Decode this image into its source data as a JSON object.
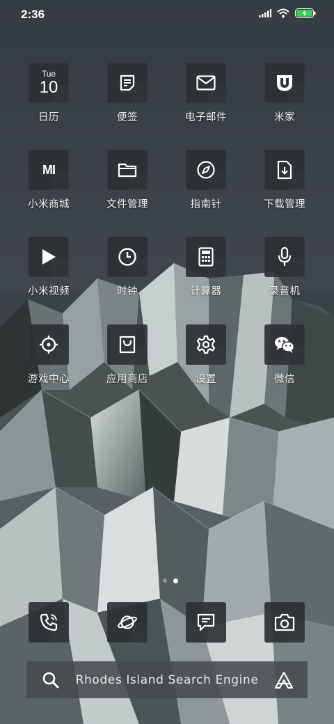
{
  "status": {
    "time": "2:36"
  },
  "calendar": {
    "dow": "Tue",
    "day": "10"
  },
  "apps": [
    {
      "label": "日历",
      "icon": "calendar-icon"
    },
    {
      "label": "便签",
      "icon": "notes-icon"
    },
    {
      "label": "电子邮件",
      "icon": "mail-icon"
    },
    {
      "label": "米家",
      "icon": "mijia-icon"
    },
    {
      "label": "小米商城",
      "icon": "mi-logo-icon",
      "logo": "MI"
    },
    {
      "label": "文件管理",
      "icon": "folder-icon"
    },
    {
      "label": "指南针",
      "icon": "compass-icon"
    },
    {
      "label": "下载管理",
      "icon": "download-icon"
    },
    {
      "label": "小米视频",
      "icon": "play-icon"
    },
    {
      "label": "时钟",
      "icon": "clock-icon"
    },
    {
      "label": "计算器",
      "icon": "calculator-icon"
    },
    {
      "label": "录音机",
      "icon": "microphone-icon"
    },
    {
      "label": "游戏中心",
      "icon": "crosshair-icon"
    },
    {
      "label": "应用商店",
      "icon": "shopping-bag-icon"
    },
    {
      "label": "设置",
      "icon": "gear-icon"
    },
    {
      "label": "微信",
      "icon": "wechat-icon"
    }
  ],
  "dock": [
    {
      "icon": "phone-icon"
    },
    {
      "icon": "planet-icon"
    },
    {
      "icon": "message-icon"
    },
    {
      "icon": "camera-icon"
    }
  ],
  "search": {
    "placeholder": "Rhodes Island Search Engine"
  }
}
